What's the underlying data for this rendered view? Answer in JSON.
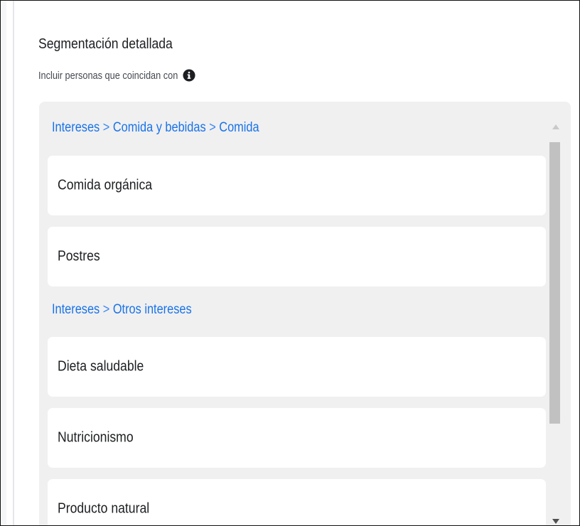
{
  "section": {
    "title": "Segmentación detallada",
    "subtitle": "Incluir personas que coincidan con",
    "info_icon": "info-circle-icon"
  },
  "groups": [
    {
      "breadcrumb": [
        "Intereses",
        ">",
        "Comida y bebidas",
        ">",
        "Comida"
      ],
      "items": [
        "Comida orgánica",
        "Postres"
      ]
    },
    {
      "breadcrumb": [
        "Intereses",
        ">",
        "Otros intereses"
      ],
      "items": [
        "Dieta saludable",
        "Nutricionismo",
        "Producto natural"
      ]
    }
  ],
  "colors": {
    "link": "#1a73e8",
    "panel_bg": "#f0f0f1",
    "card_bg": "#ffffff",
    "text": "#1c1e21"
  },
  "scrollbar": {
    "up_icon": "scroll-up-arrow-icon",
    "down_icon": "scroll-down-arrow-icon"
  }
}
